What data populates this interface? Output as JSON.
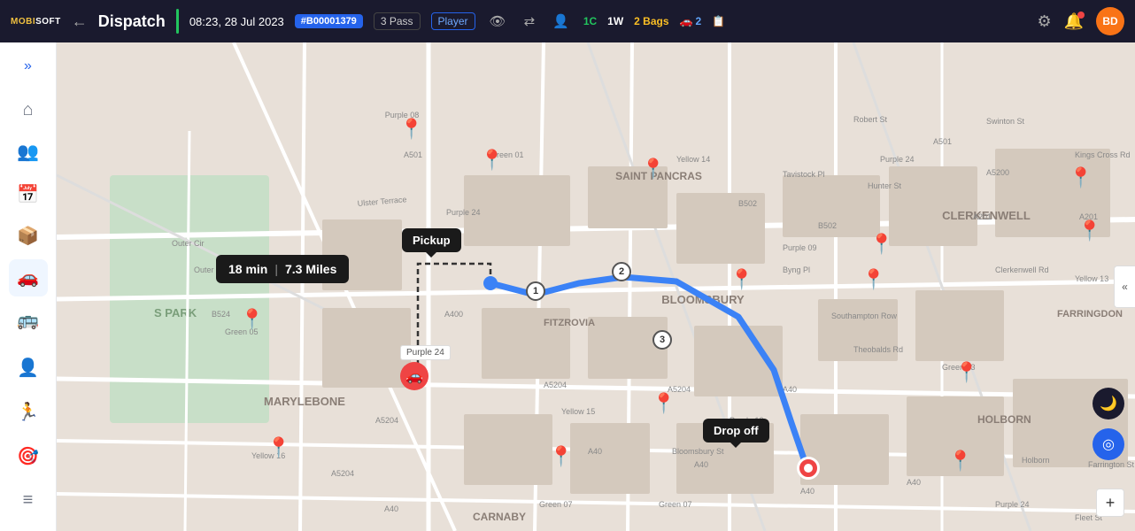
{
  "app": {
    "name": "MOBISOFT",
    "back_label": "←",
    "title": "Dispatch"
  },
  "header": {
    "time": "08:23, 28 Jul 2023",
    "booking_id": "#B00001379",
    "pass_count": "3 Pass",
    "player_label": "Player",
    "stats": [
      {
        "label": "1C",
        "color": "green"
      },
      {
        "label": "1W",
        "color": "white"
      },
      {
        "label": "2 Bags",
        "color": "yellow"
      },
      {
        "label": "2",
        "color": "blue",
        "icon": "🚗"
      },
      {
        "label": "",
        "color": "yellow",
        "icon": "📋"
      }
    ],
    "settings_icon": "⚙",
    "bell_icon": "🔔",
    "avatar": "BD"
  },
  "sidebar": {
    "expand_icon": "»",
    "items": [
      {
        "id": "home",
        "icon": "⌂",
        "active": false
      },
      {
        "id": "team",
        "icon": "👥",
        "active": false
      },
      {
        "id": "calendar",
        "icon": "📅",
        "active": false
      },
      {
        "id": "dispatch",
        "icon": "📦",
        "active": false
      },
      {
        "id": "vehicle",
        "icon": "🚗",
        "active": true
      },
      {
        "id": "fleet",
        "icon": "🚌",
        "active": false
      },
      {
        "id": "person",
        "icon": "👤",
        "active": false
      },
      {
        "id": "activity",
        "icon": "🏃",
        "active": false
      },
      {
        "id": "wheel",
        "icon": "🎯",
        "active": false
      },
      {
        "id": "settings",
        "icon": "≡",
        "active": false
      }
    ]
  },
  "map": {
    "route_info": {
      "time": "18 min",
      "distance": "7.3 Miles"
    },
    "pickup_label": "Pickup",
    "dropoff_label": "Drop off",
    "car_marker_label": "Purple 24",
    "steps": [
      "1",
      "2",
      "3"
    ],
    "dark_mode_icon": "🌙",
    "location_icon": "◎",
    "zoom_icon": "+"
  }
}
